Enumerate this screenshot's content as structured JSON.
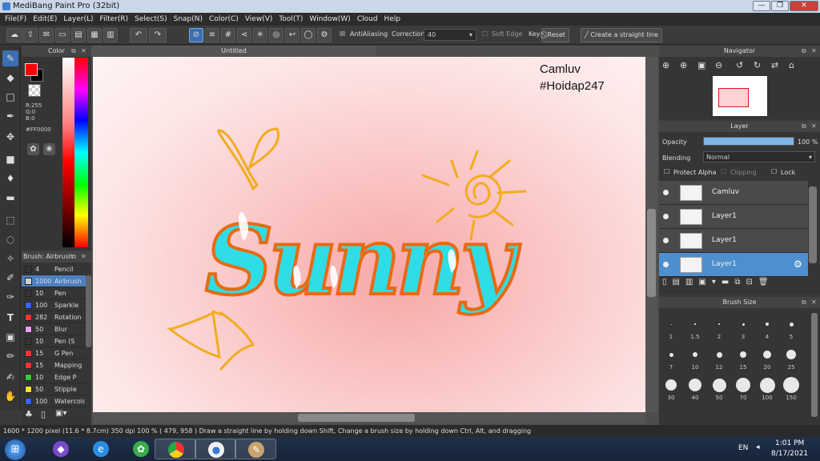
{
  "window": {
    "title": "MediBang Paint Pro (32bit)",
    "minimize": "—",
    "restore": "❐",
    "close": "✕"
  },
  "menu": [
    "File(F)",
    "Edit(E)",
    "Layer(L)",
    "Filter(R)",
    "Select(S)",
    "Snap(N)",
    "Color(C)",
    "View(V)",
    "Tool(T)",
    "Window(W)",
    "Cloud",
    "Help"
  ],
  "toolbar": {
    "antialiasing_label": "AntiAliasing",
    "correction_label": "Correction",
    "correction_value": "40",
    "soft_edge_label": "Soft Edge",
    "key_label": "Key",
    "reset_label": "Reset",
    "straight_line_label": "Create a straight line"
  },
  "color_panel": {
    "title": "Color",
    "primary_color": "#FF0000",
    "secondary_color": "#000000",
    "r": "R:255",
    "g": "G:0",
    "b": "B:0",
    "hex": "#FF0000"
  },
  "brush_panel": {
    "title": "Brush: Airbrush",
    "items": [
      {
        "size": "4",
        "name": "Pencil",
        "color": "#333333"
      },
      {
        "size": "1000",
        "name": "Airbrush",
        "color": "#d0d0d0"
      },
      {
        "size": "10",
        "name": "Pen",
        "color": "#333333"
      },
      {
        "size": "100",
        "name": "Sparkle",
        "color": "#3366ff"
      },
      {
        "size": "282",
        "name": "Rotation",
        "color": "#ff3333"
      },
      {
        "size": "50",
        "name": "Blur",
        "color": "#ff99ff"
      },
      {
        "size": "10",
        "name": "Pen (S",
        "color": "#333333"
      },
      {
        "size": "15",
        "name": "G Pen",
        "color": "#ff3333"
      },
      {
        "size": "15",
        "name": "Mapping",
        "color": "#ff3333"
      },
      {
        "size": "10",
        "name": "Edge P",
        "color": "#33cc33"
      },
      {
        "size": "50",
        "name": "Stipple",
        "color": "#ffdd33"
      },
      {
        "size": "100",
        "name": "Watercolor",
        "color": "#3366ff"
      }
    ]
  },
  "document": {
    "tab_title": "Untitled",
    "watermark_line1": "Camluv",
    "watermark_line2": "#Hoidap247",
    "artwork_text": "Sunny"
  },
  "navigator": {
    "title": "Navigator"
  },
  "layer_panel": {
    "title": "Layer",
    "opacity_label": "Opacity",
    "opacity_value": "100 %",
    "opacity_fraction": 1.0,
    "blending_label": "Blending",
    "blending_value": "Normal",
    "protect_alpha_label": "Protect Alpha",
    "clipping_label": "Clipping",
    "lock_label": "Lock",
    "layers": [
      {
        "name": "Camluv",
        "selected": false
      },
      {
        "name": "Layer1",
        "selected": false
      },
      {
        "name": "Layer1",
        "selected": false
      },
      {
        "name": "Layer1",
        "selected": true
      }
    ]
  },
  "brush_size_panel": {
    "title": "Brush Size",
    "sizes": [
      "1",
      "1.5",
      "2",
      "3",
      "4",
      "5",
      "7",
      "10",
      "12",
      "15",
      "20",
      "25",
      "30",
      "40",
      "50",
      "70",
      "100",
      "150"
    ]
  },
  "status": {
    "text": "1600 * 1200 pixel   (11.6 * 8.7cm)   350 dpi   100 %   ( 479, 958 )   Draw a straight line by holding down Shift, Change a brush size by holding down Ctrl, Alt, and dragging"
  },
  "taskbar": {
    "language": "EN",
    "time": "1:01 PM",
    "date": "8/17/2021"
  }
}
